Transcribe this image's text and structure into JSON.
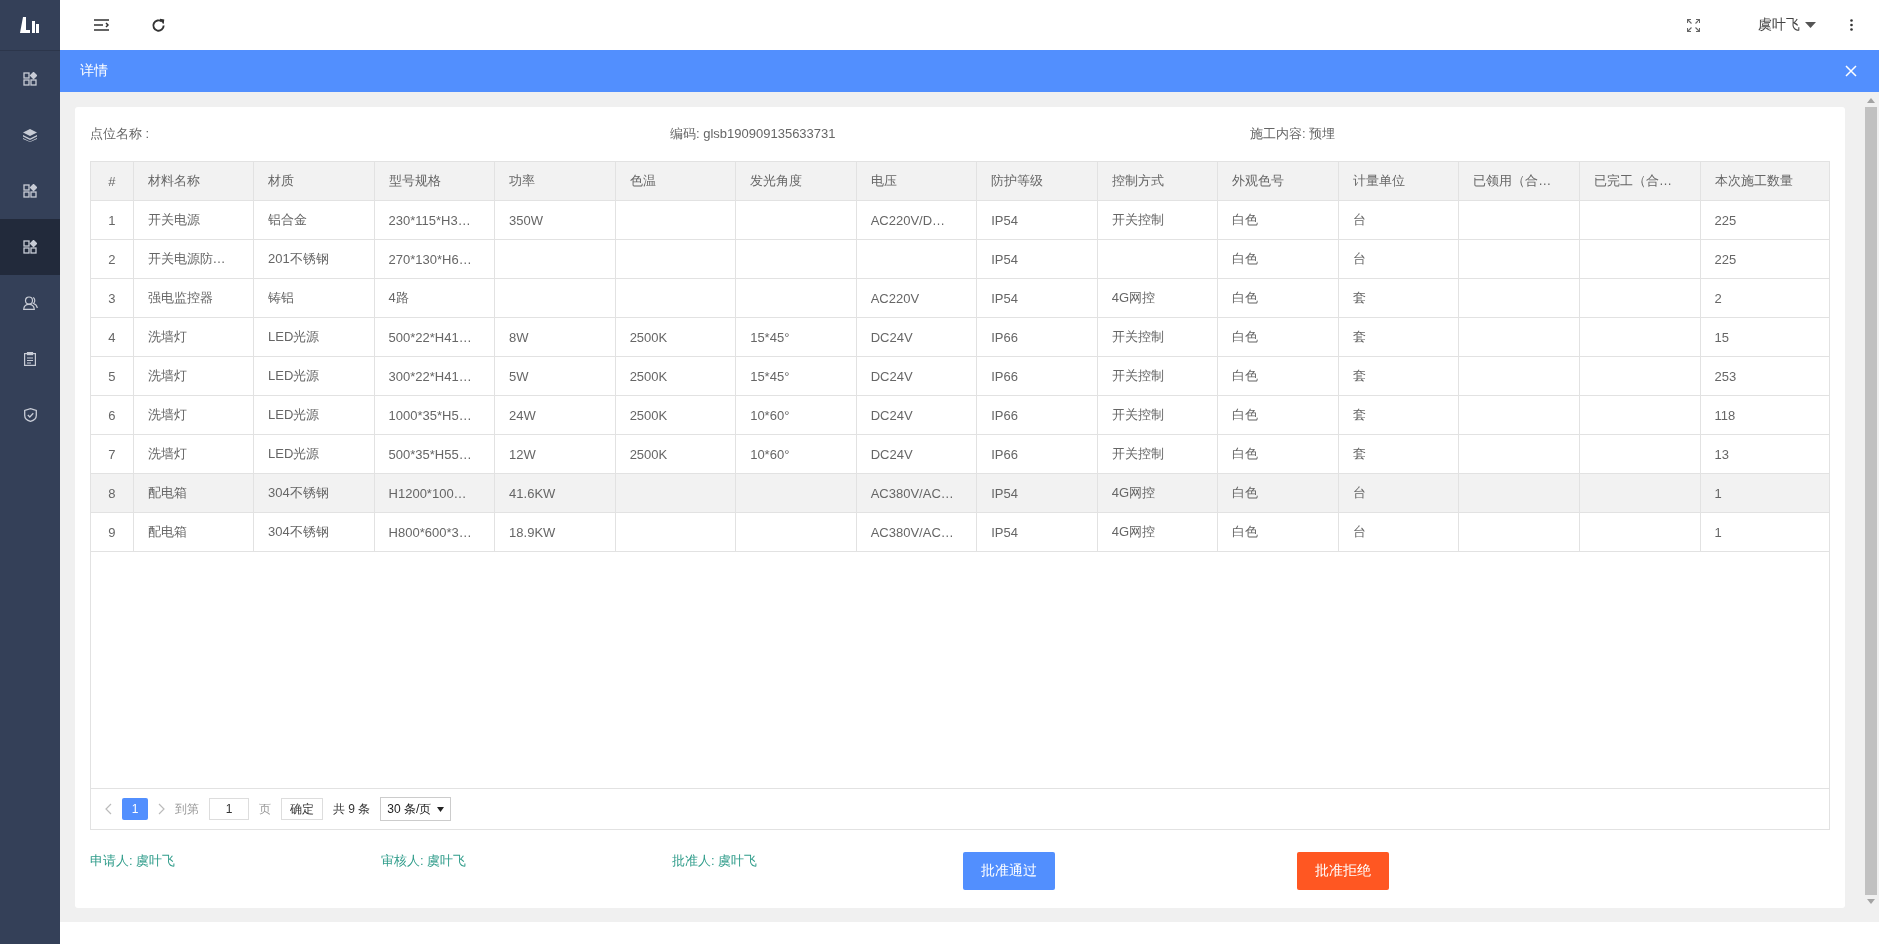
{
  "sidebar": {
    "items": [
      {
        "kind": "grid",
        "selected": false
      },
      {
        "kind": "layers",
        "selected": false
      },
      {
        "kind": "grid",
        "selected": false
      },
      {
        "kind": "grid",
        "selected": true
      },
      {
        "kind": "user",
        "selected": false
      },
      {
        "kind": "clipboard",
        "selected": false
      },
      {
        "kind": "shield",
        "selected": false
      }
    ]
  },
  "topbar": {
    "user": "虞叶飞"
  },
  "dialog": {
    "title": "详情",
    "info": [
      {
        "label": "点位名称 :"
      },
      {
        "label": "编码:",
        "value": "glsb190909135633731"
      },
      {
        "label": "施工内容:",
        "value": "预埋"
      }
    ],
    "table": {
      "columns": [
        "#",
        "材料名称",
        "材质",
        "型号规格",
        "功率",
        "色温",
        "发光角度",
        "电压",
        "防护等级",
        "控制方式",
        "外观色号",
        "计量单位",
        "已领用（合…",
        "已完工（合…",
        "本次施工数量"
      ],
      "rows": [
        {
          "highlighted": false,
          "cells": [
            "1",
            "开关电源",
            "铝合金",
            "230*115*H3…",
            "350W",
            "",
            "",
            "AC220V/D…",
            "IP54",
            "开关控制",
            "白色",
            "台",
            "",
            "",
            "225"
          ]
        },
        {
          "highlighted": false,
          "cells": [
            "2",
            "开关电源防…",
            "201不锈钢",
            "270*130*H6…",
            "",
            "",
            "",
            "",
            "IP54",
            "",
            "白色",
            "台",
            "",
            "",
            "225"
          ]
        },
        {
          "highlighted": false,
          "cells": [
            "3",
            "强电监控器",
            "铸铝",
            "4路",
            "",
            "",
            "",
            "AC220V",
            "IP54",
            "4G网控",
            "白色",
            "套",
            "",
            "",
            "2"
          ]
        },
        {
          "highlighted": false,
          "cells": [
            "4",
            "洗墙灯",
            "LED光源",
            "500*22*H41…",
            "8W",
            "2500K",
            "15*45°",
            "DC24V",
            "IP66",
            "开关控制",
            "白色",
            "套",
            "",
            "",
            "15"
          ]
        },
        {
          "highlighted": false,
          "cells": [
            "5",
            "洗墙灯",
            "LED光源",
            "300*22*H41…",
            "5W",
            "2500K",
            "15*45°",
            "DC24V",
            "IP66",
            "开关控制",
            "白色",
            "套",
            "",
            "",
            "253"
          ]
        },
        {
          "highlighted": false,
          "cells": [
            "6",
            "洗墙灯",
            "LED光源",
            "1000*35*H5…",
            "24W",
            "2500K",
            "10*60°",
            "DC24V",
            "IP66",
            "开关控制",
            "白色",
            "套",
            "",
            "",
            "118"
          ]
        },
        {
          "highlighted": false,
          "cells": [
            "7",
            "洗墙灯",
            "LED光源",
            "500*35*H55…",
            "12W",
            "2500K",
            "10*60°",
            "DC24V",
            "IP66",
            "开关控制",
            "白色",
            "套",
            "",
            "",
            "13"
          ]
        },
        {
          "highlighted": true,
          "cells": [
            "8",
            "配电箱",
            "304不锈钢",
            "H1200*100…",
            "41.6KW",
            "",
            "",
            "AC380V/AC…",
            "IP54",
            "4G网控",
            "白色",
            "台",
            "",
            "",
            "1"
          ]
        },
        {
          "highlighted": false,
          "cells": [
            "9",
            "配电箱",
            "304不锈钢",
            "H800*600*3…",
            "18.9KW",
            "",
            "",
            "AC380V/AC…",
            "IP54",
            "4G网控",
            "白色",
            "台",
            "",
            "",
            "1"
          ]
        }
      ]
    },
    "pagination": {
      "pages": [
        {
          "label": "1",
          "selected": true
        }
      ],
      "goto_label": "到第",
      "goto_value": "1",
      "page_label": "页",
      "confirm": "确定",
      "total": "共 9 条",
      "page_size": "30 条/页"
    },
    "signers": [
      "申请人: 虞叶飞",
      "审核人: 虞叶飞",
      "批准人: 虞叶飞"
    ],
    "buttons": [
      {
        "label": "批准通过",
        "kind": "approve"
      },
      {
        "label": "批准拒绝",
        "kind": "reject"
      }
    ]
  }
}
